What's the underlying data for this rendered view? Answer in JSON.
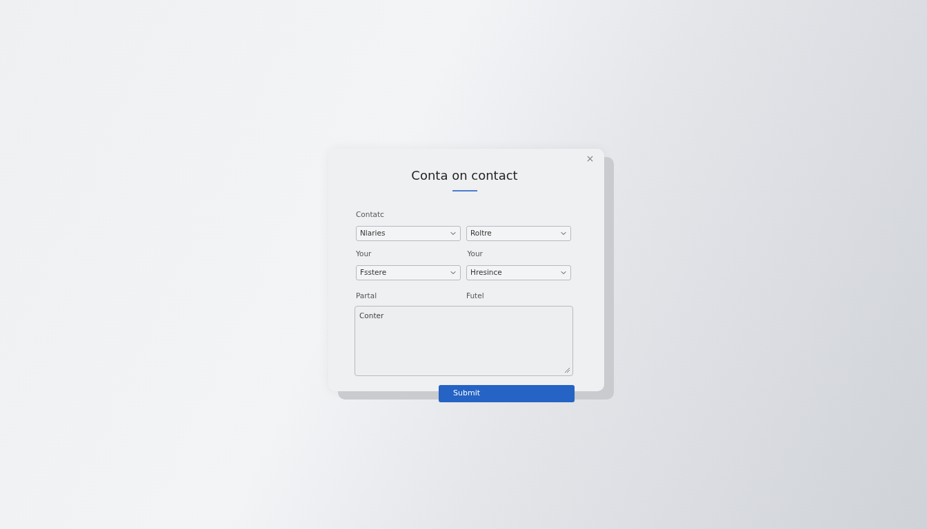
{
  "dialog": {
    "title": "Conta on contact",
    "rows": [
      {
        "labels": [
          "Contatc"
        ],
        "selects": [
          "Nlaries",
          "Roltre"
        ]
      },
      {
        "labels": [
          "Your",
          "Your"
        ],
        "selects": [
          "Fsstere",
          "Hresince"
        ]
      }
    ],
    "message": {
      "labels": [
        "Partal",
        "Futel"
      ],
      "value": "Conter"
    },
    "submit": "Submit"
  }
}
